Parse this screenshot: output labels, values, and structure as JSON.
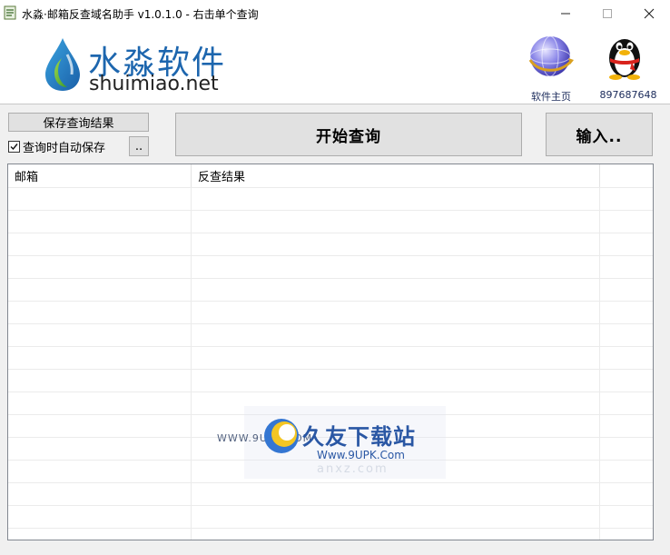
{
  "window": {
    "title": "水淼·邮箱反查域名助手 v1.0.1.0 - 右击单个查询"
  },
  "header": {
    "brand_cn": "水淼软件",
    "brand_en": "shuimiao.net",
    "home_label": "软件主页",
    "qq_label": "897687648"
  },
  "toolbar": {
    "save_results_label": "保存查询结果",
    "auto_save_label": "查询时自动保存",
    "auto_save_checked": true,
    "browse_label": "..",
    "start_label": "开始查询",
    "input_label": "输入.."
  },
  "table": {
    "columns": [
      "邮箱",
      "反查结果",
      ""
    ],
    "rows": []
  },
  "watermark": {
    "left_text": "WWW.9UPK.COM",
    "cn_text": "久友下载站",
    "en_text": "Www.9UPK.Com",
    "ghost_text": "anxz.com"
  },
  "icons": {
    "app": "app-icon",
    "logo": "water-drop-logo-icon",
    "home": "globe-icon",
    "qq": "qq-penguin-icon"
  }
}
